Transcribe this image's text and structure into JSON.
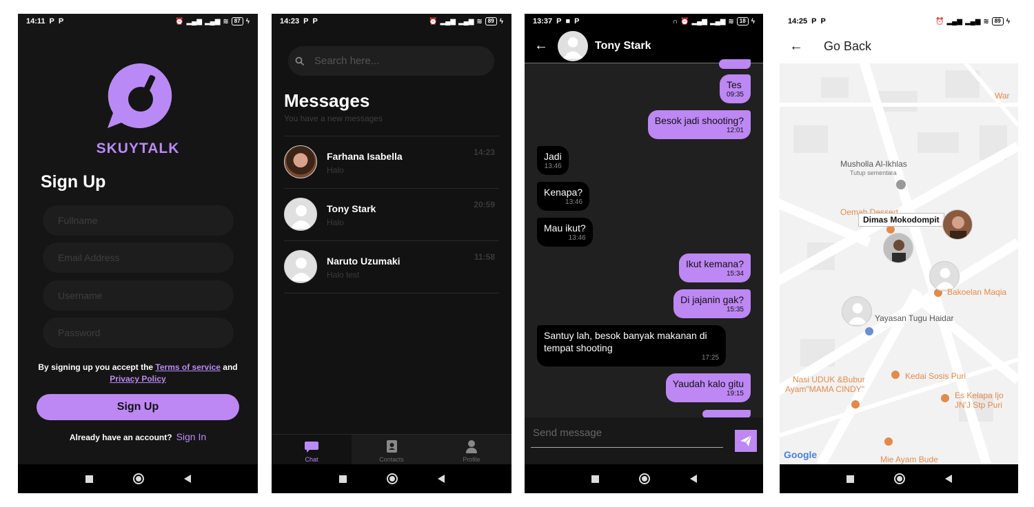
{
  "signup": {
    "status_time": "14:11",
    "battery": "87",
    "brand": "SKUYTALK",
    "title": "Sign Up",
    "fields": {
      "fullname": "Fullname",
      "email": "Email Address",
      "username": "Username",
      "password": "Password"
    },
    "terms_prefix": "By signing up you accept the",
    "terms_link": "Terms of service",
    "terms_and": "and",
    "privacy_link": "Privacy Policy",
    "button": "Sign Up",
    "already": "Already have an account?",
    "signin": "Sign In"
  },
  "messages": {
    "status_time": "14:23",
    "battery": "89",
    "search_placeholder": "Search here...",
    "title": "Messages",
    "subtitle": "You have a new messages",
    "chats": [
      {
        "name": "Farhana Isabella",
        "preview": "Halo",
        "time": "14:23"
      },
      {
        "name": "Tony Stark",
        "preview": "Halo",
        "time": "20:59"
      },
      {
        "name": "Naruto Uzumaki",
        "preview": "Halo test",
        "time": "11:58"
      }
    ],
    "tabs": {
      "chat": "Chat",
      "contacts": "Contacts",
      "profile": "Profile"
    }
  },
  "conversation": {
    "status_time": "13:37",
    "battery": "18",
    "contact": "Tony Stark",
    "messages": [
      {
        "text": "Tes",
        "time": "09:35"
      },
      {
        "text": "Besok jadi shooting?",
        "time": "12:01"
      },
      {
        "text": "Jadi",
        "time": "13:46"
      },
      {
        "text": "Kenapa?",
        "time": "13:46"
      },
      {
        "text": "Mau ikut?",
        "time": "13:46"
      },
      {
        "text": "Ikut kemana?",
        "time": "15:34"
      },
      {
        "text": "Di jajanin gak?",
        "time": "15:35"
      },
      {
        "text": "Santuy lah, besok banyak makanan di tempat shooting",
        "time": "17:25"
      },
      {
        "text": "Yaudah kalo gitu",
        "time": "19:15"
      }
    ],
    "input_placeholder": "Send message"
  },
  "map": {
    "status_time": "14:25",
    "battery": "89",
    "header": "Go Back",
    "tooltip": "Dimas Mokodompit",
    "labels": {
      "war": "War",
      "musholla": "Musholla Al-Ikhlas",
      "musholla_sub": "Tutup sementara",
      "oemah": "Oemah Dessert",
      "bakoelan": "Bakoelan Maqia",
      "yayasan": "Yayasan Tugu Haidar",
      "nasi": "Nasi UDUK &Bubur",
      "nasi2": "Ayam\"MAMA CINDY\"",
      "sosis": "Kedai Sosis Puri",
      "kelapa": "Es Kelapa Ijo",
      "kelapa2": "JN'J Stp Puri",
      "mie": "Mie Ayam Bude"
    },
    "google": "Google"
  },
  "colors": {
    "accent": "#bd87f4",
    "dark_bg": "#151515"
  }
}
